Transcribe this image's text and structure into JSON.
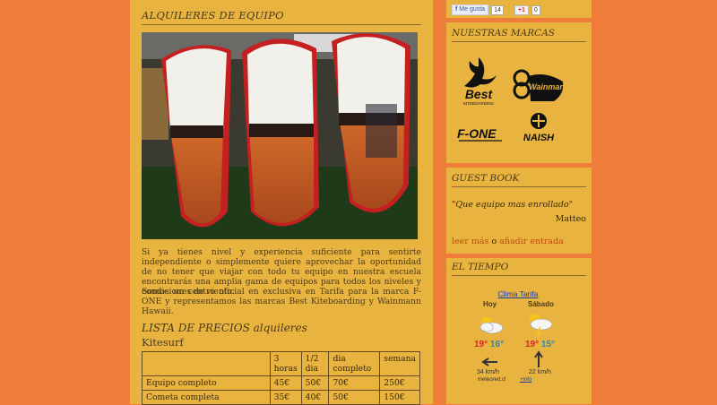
{
  "main": {
    "title": "ALQUILERES DE EQUIPO",
    "paragraph1": "Si ya tienes nivel y experiencia suficiente para sentirte independiente o simplemente quiere aprovechar la oportunidad de no tener que viajar con todo tu equipo en nuestra escuela encontrarás una amplia gama de equipos para todos los niveles y condiciones de viento.",
    "paragraph2": "Somos un centro oficial en exclusiva en Tarifa para la marca F-ONE y representamos las marcas Best Kiteboarding y Wainmann Hawaii.",
    "prices_title": "LISTA DE PRECIOS alquileres",
    "prices_subtitle": "Kitesurf",
    "table": {
      "headers": [
        "",
        "3 horas",
        "1/2 dia",
        "dia completo",
        "semana"
      ],
      "rows": [
        [
          "Equipo completo",
          "45€",
          "50€",
          "70€",
          "250€"
        ],
        [
          "Cometa completa",
          "35€",
          "40€",
          "50€",
          "150€"
        ]
      ]
    }
  },
  "social": {
    "like_label": "Me gusta",
    "like_count": "14",
    "plus_label": "+1",
    "plus_count": "0"
  },
  "brands": {
    "title": "NUESTRAS MARCAS",
    "logos": [
      "Best Kiteboarding",
      "Wainmann Hawaii",
      "F-ONE",
      "Naish"
    ]
  },
  "guestbook": {
    "title": "GUEST BOOK",
    "quote": "\"Que equipo mas enrollado\"",
    "author": "Matteo",
    "read_more": "leer más",
    "or": "o",
    "add_entry": "añadir entrada"
  },
  "weather": {
    "title": "EL TIEMPO",
    "link": "Clima Tarifa",
    "days": [
      {
        "label": "Hoy",
        "max": "19°",
        "min": "16°",
        "wind": "34 km/h"
      },
      {
        "label": "Sábado",
        "max": "19°",
        "min": "15°",
        "wind": "22 km/h"
      }
    ],
    "source": "meteored.cl",
    "info": "+info"
  },
  "colors": {
    "background": "#f07c3a",
    "panel": "#e8b33f",
    "link": "#c24a10"
  }
}
